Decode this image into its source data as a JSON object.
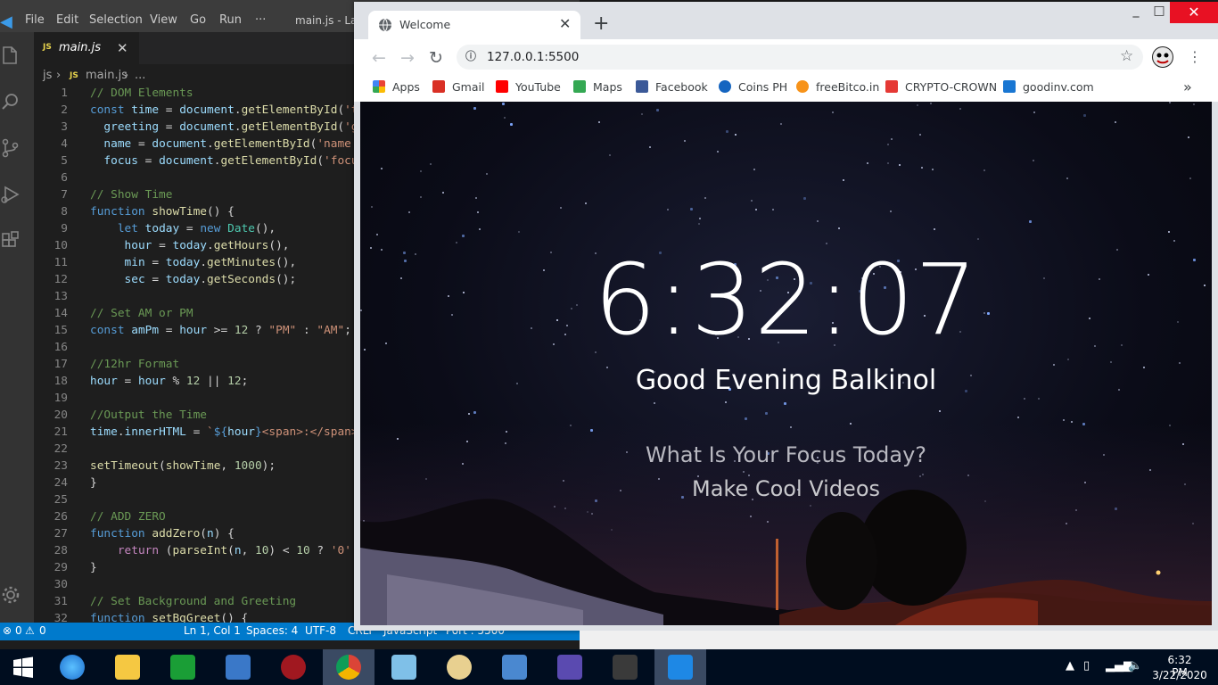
{
  "vscode": {
    "menu": [
      "File",
      "Edit",
      "Selection",
      "View",
      "Go",
      "Run",
      "···"
    ],
    "window_title": "main.js - Lar",
    "tab": {
      "label": "main.js",
      "badge": "JS"
    },
    "breadcrumb": {
      "folder": "js",
      "file": "main.js",
      "rest": "..."
    },
    "line_numbers": [
      "1",
      "2",
      "3",
      "4",
      "5",
      "6",
      "7",
      "8",
      "9",
      "10",
      "11",
      "12",
      "13",
      "14",
      "15",
      "16",
      "17",
      "18",
      "19",
      "20",
      "21",
      "22",
      "23",
      "24",
      "25",
      "26",
      "27",
      "28",
      "29",
      "30",
      "31",
      "32"
    ],
    "status": {
      "errors": "0",
      "warnings": "0",
      "position": "Ln 1, Col 1",
      "spaces": "Spaces: 4",
      "encoding": "UTF-8",
      "eol": "CRLF",
      "language": "JavaScript",
      "port": "Port : 5500"
    }
  },
  "chrome": {
    "tab_title": "Welcome",
    "url": "127.0.0.1:5500",
    "bookmarks": [
      {
        "label": "Apps",
        "color": "#ea4335"
      },
      {
        "label": "Gmail",
        "color": "#d93025"
      },
      {
        "label": "YouTube",
        "color": "#ff0000"
      },
      {
        "label": "Maps",
        "color": "#34a853"
      },
      {
        "label": "Facebook",
        "color": "#3b5998"
      },
      {
        "label": "Coins PH",
        "color": "#1565c0"
      },
      {
        "label": "freeBitco.in",
        "color": "#f7931a"
      },
      {
        "label": "CRYPTO-CROWN",
        "color": "#e53935"
      },
      {
        "label": "goodinv.com",
        "color": "#1976d2"
      }
    ]
  },
  "page": {
    "time": "6:32:07",
    "greeting": "Good Evening Balkinol",
    "focus_question": "What Is Your Focus Today?",
    "focus_answer": "Make Cool Videos"
  },
  "taskbar": {
    "time": "6:32 PM",
    "date": "3/22/2020",
    "apps": [
      "start",
      "internet-explorer",
      "file-explorer",
      "store",
      "remote-desktop",
      "media",
      "chrome",
      "notepad",
      "paint",
      "network",
      "settings",
      "sublime-text",
      "vscode"
    ]
  }
}
